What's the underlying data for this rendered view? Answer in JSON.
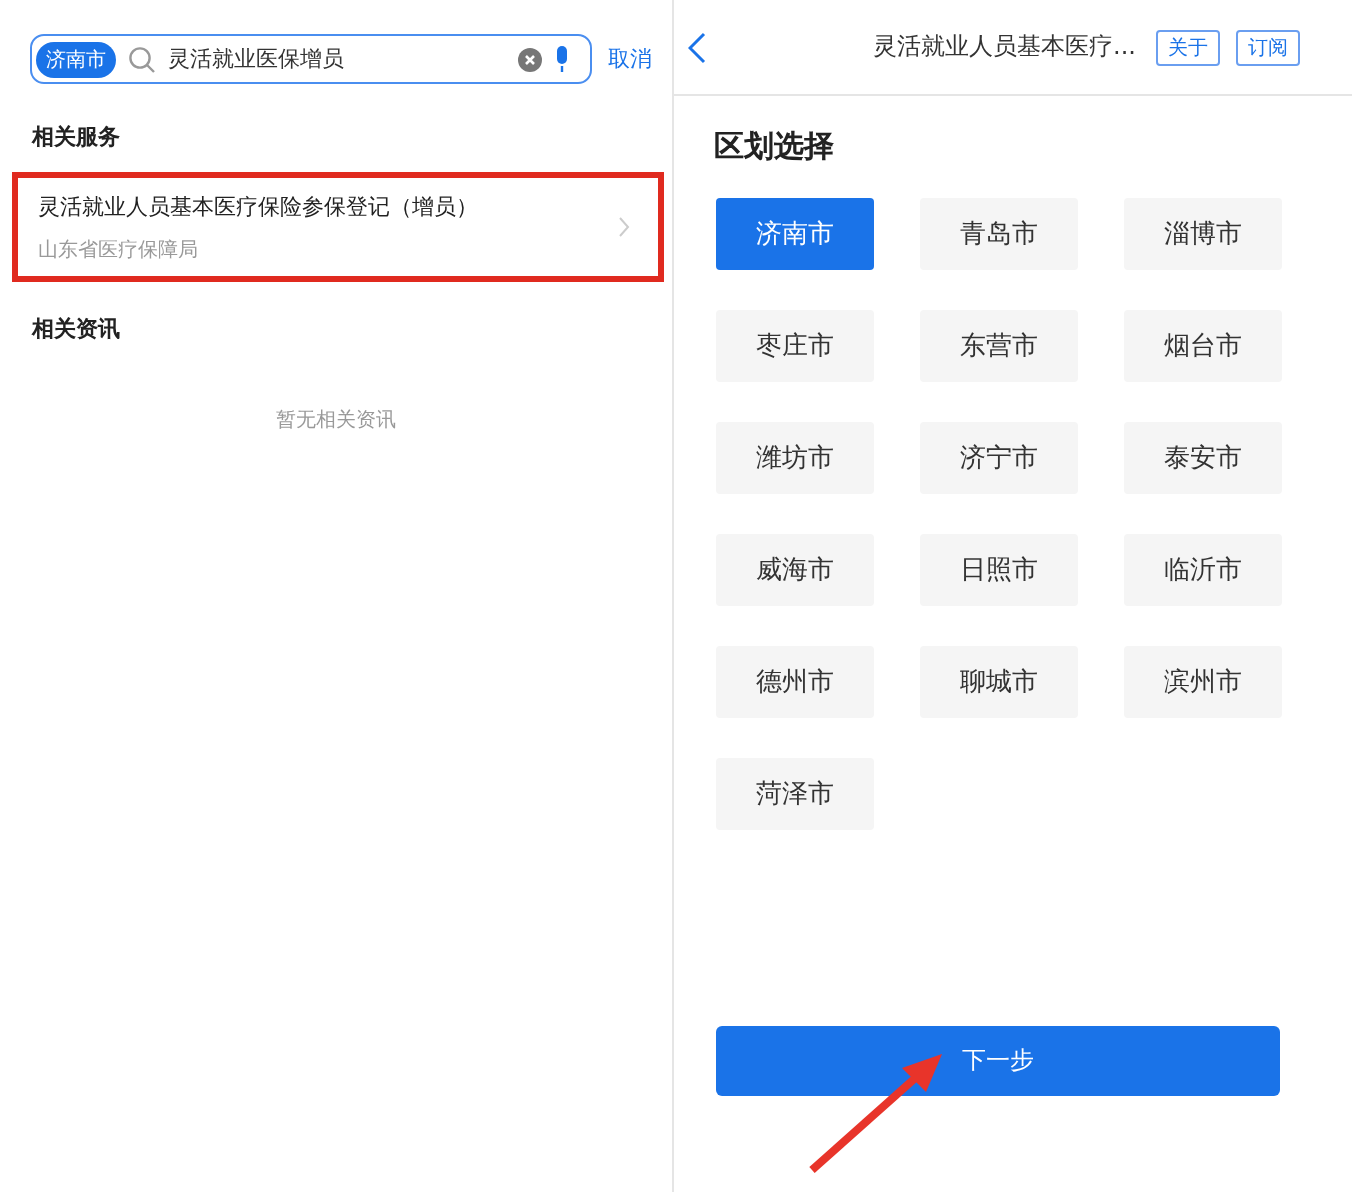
{
  "search": {
    "region": "济南市",
    "value": "灵活就业医保增员",
    "cancel": "取消"
  },
  "services": {
    "heading": "相关服务",
    "items": [
      {
        "title": "灵活就业人员基本医疗保险参保登记（增员）",
        "source": "山东省医疗保障局",
        "highlighted": true
      }
    ]
  },
  "news": {
    "heading": "相关资讯",
    "empty": "暂无相关资讯"
  },
  "header": {
    "title": "灵活就业人员基本医疗...",
    "buttons": [
      "关于",
      "订阅"
    ]
  },
  "region_select": {
    "heading": "区划选择",
    "cities": [
      {
        "name": "济南市",
        "selected": true
      },
      {
        "name": "青岛市",
        "selected": false
      },
      {
        "name": "淄博市",
        "selected": false
      },
      {
        "name": "枣庄市",
        "selected": false
      },
      {
        "name": "东营市",
        "selected": false
      },
      {
        "name": "烟台市",
        "selected": false
      },
      {
        "name": "潍坊市",
        "selected": false
      },
      {
        "name": "济宁市",
        "selected": false
      },
      {
        "name": "泰安市",
        "selected": false
      },
      {
        "name": "威海市",
        "selected": false
      },
      {
        "name": "日照市",
        "selected": false
      },
      {
        "name": "临沂市",
        "selected": false
      },
      {
        "name": "德州市",
        "selected": false
      },
      {
        "name": "聊城市",
        "selected": false
      },
      {
        "name": "滨州市",
        "selected": false
      },
      {
        "name": "菏泽市",
        "selected": false
      }
    ]
  },
  "next_button": "下一步"
}
